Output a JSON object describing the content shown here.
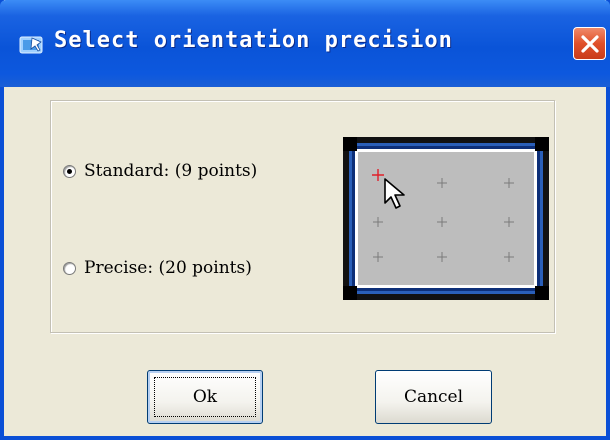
{
  "window": {
    "title": "Select orientation precision",
    "colors": {
      "titlebar": "#0a54d8",
      "close": "#e0502a",
      "face": "#ece9d8"
    }
  },
  "options": [
    {
      "label": "Standard: (9 points)",
      "selected": true
    },
    {
      "label": "Precise: (20 points)",
      "selected": false
    }
  ],
  "preview": {
    "grid": "3x3",
    "highlighted_point": "top-left",
    "highlight_color": "#e0202a",
    "point_color": "#7a7a7a"
  },
  "buttons": {
    "ok_label": "Ok",
    "cancel_label": "Cancel"
  }
}
